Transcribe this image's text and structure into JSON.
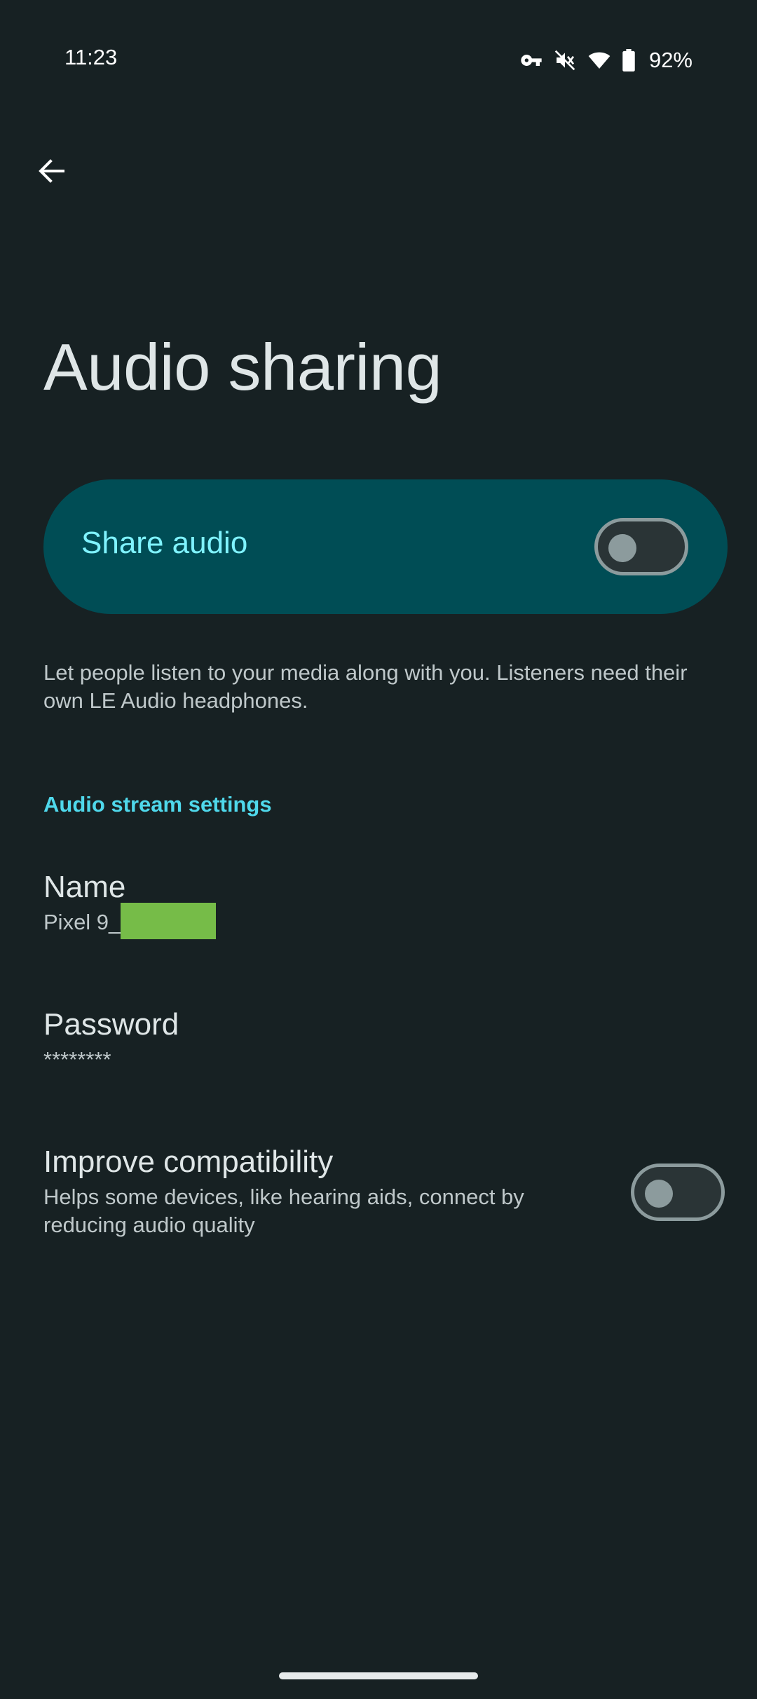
{
  "status_bar": {
    "time": "11:23",
    "battery_percent": "92%",
    "icons": [
      "vpn-key-icon",
      "mute-icon",
      "wifi-icon",
      "battery-icon"
    ]
  },
  "header": {
    "back_icon": "back-arrow-icon",
    "title": "Audio sharing"
  },
  "share_audio": {
    "label": "Share audio",
    "enabled": false
  },
  "description": "Let people listen to your media along with you. Listeners need their own LE Audio headphones.",
  "section": {
    "title": "Audio stream settings"
  },
  "settings": {
    "name": {
      "title": "Name",
      "value_prefix": "Pixel 9_"
    },
    "password": {
      "title": "Password",
      "value": "********"
    },
    "improve_compatibility": {
      "title": "Improve compatibility",
      "summary": "Helps some devices, like hearing aids, connect by reducing audio quality",
      "enabled": false
    }
  },
  "colors": {
    "background": "#172123",
    "card": "#004d55",
    "accent": "#7ff3ff",
    "section_accent": "#4fd8eb",
    "redaction": "#76bc48"
  }
}
